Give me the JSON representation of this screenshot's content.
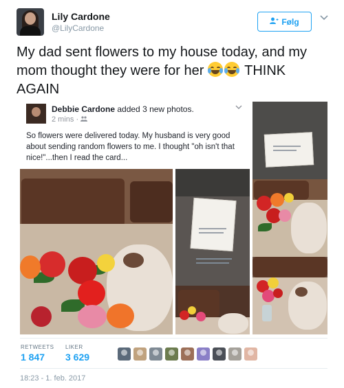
{
  "header": {
    "name": "Lily Cardone",
    "handle": "@LilyCardone",
    "follow_label": "Følg",
    "avatar_icon": "profile-photo",
    "follow_icon": "add-person-icon",
    "menu_icon": "chevron-down-icon"
  },
  "tweet": {
    "text_part1": "My dad sent flowers to my house today, and my mom thought they were for her",
    "emoji": "face-with-tears-of-joy",
    "text_part2": "THINK AGAIN"
  },
  "embedded_post": {
    "author": "Debbie Cardone",
    "action": "added 3 new photos.",
    "time": "2 mins",
    "privacy_icon": "friends-icon",
    "body": "So flowers were delivered today. My husband is very good about sending random flowers to me. I thought \"oh isn't that nice!\"...then I read the card..."
  },
  "stats": {
    "retweets_label": "RETWEETS",
    "retweets_value": "1 847",
    "likes_label": "LIKER",
    "likes_value": "3 629"
  },
  "likers": [
    {
      "icon": "liker-avatar-1",
      "color": "#5b6a7a"
    },
    {
      "icon": "liker-avatar-2",
      "color": "#c0a27e"
    },
    {
      "icon": "liker-avatar-3",
      "color": "#7f8a94"
    },
    {
      "icon": "liker-avatar-4",
      "color": "#6c7c4f"
    },
    {
      "icon": "liker-avatar-5",
      "color": "#9c6f58"
    },
    {
      "icon": "liker-avatar-6",
      "color": "#8a7fc7"
    },
    {
      "icon": "liker-avatar-7",
      "color": "#4b4f57"
    },
    {
      "icon": "liker-avatar-8",
      "color": "#a5a19a"
    },
    {
      "icon": "liker-avatar-9",
      "color": "#e1b6a4"
    }
  ],
  "timestamp": "18:23 - 1. feb. 2017",
  "colors": {
    "accent": "#1da1f2",
    "text": "#14171a",
    "muted": "#8899a6"
  }
}
